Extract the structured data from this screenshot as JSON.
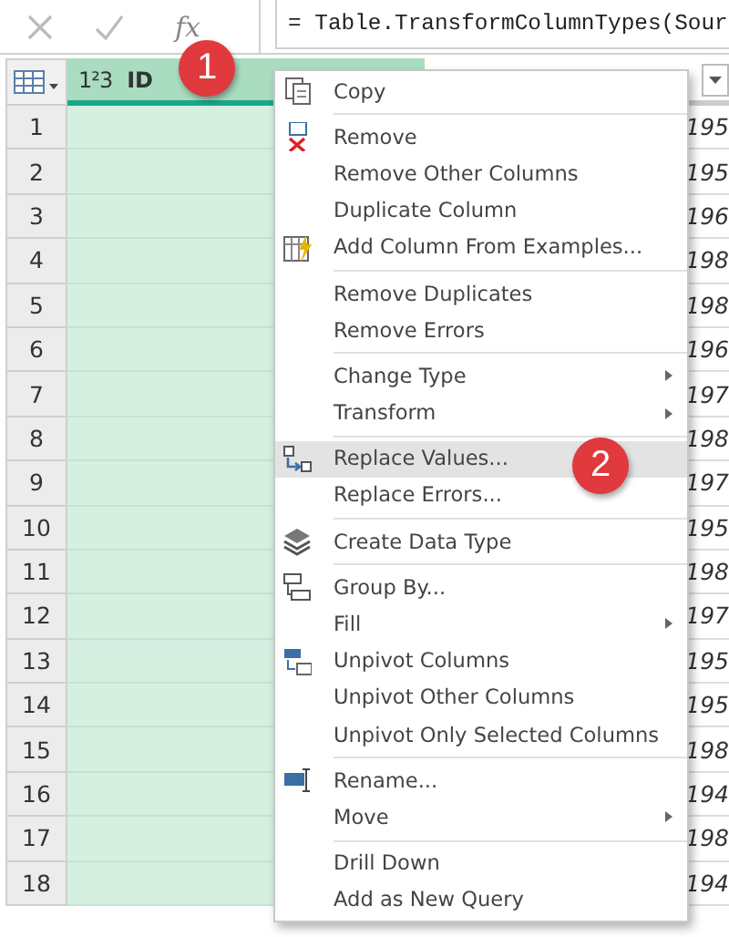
{
  "formula_bar": {
    "fx_label": "fx",
    "formula": "= Table.TransformColumnTypes(Sour"
  },
  "grid": {
    "id_column": {
      "type_label": "1²3",
      "label": "ID",
      "selected": true
    },
    "rows": [
      {
        "number": "1",
        "column_2": "195"
      },
      {
        "number": "2",
        "column_2": "195"
      },
      {
        "number": "3",
        "column_2": "196"
      },
      {
        "number": "4",
        "column_2": "198"
      },
      {
        "number": "5",
        "column_2": "198"
      },
      {
        "number": "6",
        "column_2": "196"
      },
      {
        "number": "7",
        "column_2": "197"
      },
      {
        "number": "8",
        "column_2": "198"
      },
      {
        "number": "9",
        "column_2": "197"
      },
      {
        "number": "10",
        "column_2": "195"
      },
      {
        "number": "11",
        "column_2": "198"
      },
      {
        "number": "12",
        "column_2": "197"
      },
      {
        "number": "13",
        "column_2": "195"
      },
      {
        "number": "14",
        "column_2": "195"
      },
      {
        "number": "15",
        "column_2": "198"
      },
      {
        "number": "16",
        "column_2": "194"
      },
      {
        "number": "17",
        "column_2": "198"
      },
      {
        "number": "18",
        "column_2": "194"
      }
    ]
  },
  "menu": {
    "sections": [
      {
        "items": [
          {
            "label": "Copy",
            "submenu": false,
            "selected": false
          }
        ]
      },
      {
        "items": [
          {
            "label": "Remove",
            "submenu": false,
            "selected": false
          },
          {
            "label": "Remove Other Columns",
            "submenu": false,
            "selected": false
          },
          {
            "label": "Duplicate Column",
            "submenu": false,
            "selected": false
          },
          {
            "label": "Add Column From Examples...",
            "submenu": false,
            "selected": false
          }
        ]
      },
      {
        "items": [
          {
            "label": "Remove Duplicates",
            "submenu": false,
            "selected": false
          },
          {
            "label": "Remove Errors",
            "submenu": false,
            "selected": false
          }
        ]
      },
      {
        "items": [
          {
            "label": "Change Type",
            "submenu": true,
            "selected": false
          },
          {
            "label": "Transform",
            "submenu": true,
            "selected": false
          }
        ]
      },
      {
        "items": [
          {
            "label": "Replace Values...",
            "submenu": false,
            "selected": true
          },
          {
            "label": "Replace Errors...",
            "submenu": false,
            "selected": false
          }
        ]
      },
      {
        "items": [
          {
            "label": "Create Data Type",
            "submenu": false,
            "selected": false
          }
        ]
      },
      {
        "items": [
          {
            "label": "Group By...",
            "submenu": false,
            "selected": false
          },
          {
            "label": "Fill",
            "submenu": true,
            "selected": false
          },
          {
            "label": "Unpivot Columns",
            "submenu": false,
            "selected": false
          },
          {
            "label": "Unpivot Other Columns",
            "submenu": false,
            "selected": false
          },
          {
            "label": "Unpivot Only Selected Columns",
            "submenu": false,
            "selected": false
          }
        ]
      },
      {
        "items": [
          {
            "label": "Rename...",
            "submenu": false,
            "selected": false
          },
          {
            "label": "Move",
            "submenu": true,
            "selected": false
          }
        ]
      },
      {
        "items": [
          {
            "label": "Drill Down",
            "submenu": false,
            "selected": false
          },
          {
            "label": "Add as New Query",
            "submenu": false,
            "selected": false
          }
        ]
      }
    ]
  },
  "callouts": [
    {
      "label": "1"
    },
    {
      "label": "2"
    }
  ]
}
